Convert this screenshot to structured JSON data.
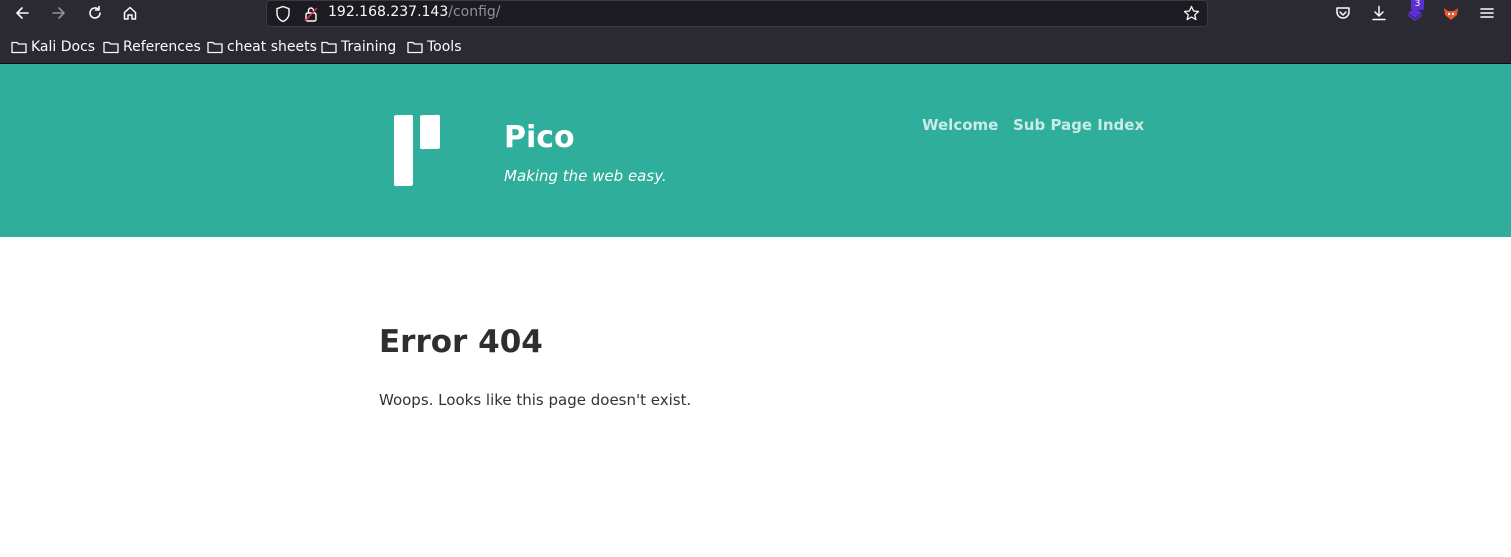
{
  "browser": {
    "url_host": "192.168.237.143",
    "url_path": "/config/",
    "extension_badge": "3",
    "bookmarks": [
      {
        "label": "Kali Docs"
      },
      {
        "label": "References"
      },
      {
        "label": "cheat sheets"
      },
      {
        "label": "Training"
      },
      {
        "label": "Tools"
      }
    ]
  },
  "site": {
    "title": "Pico",
    "tagline": "Making the web easy.",
    "nav": [
      {
        "label": "Welcome"
      },
      {
        "label": "Sub Page Index"
      }
    ],
    "header_color": "#2fae9b"
  },
  "content": {
    "error_title": "Error 404",
    "error_message": "Woops. Looks like this page doesn't exist."
  }
}
